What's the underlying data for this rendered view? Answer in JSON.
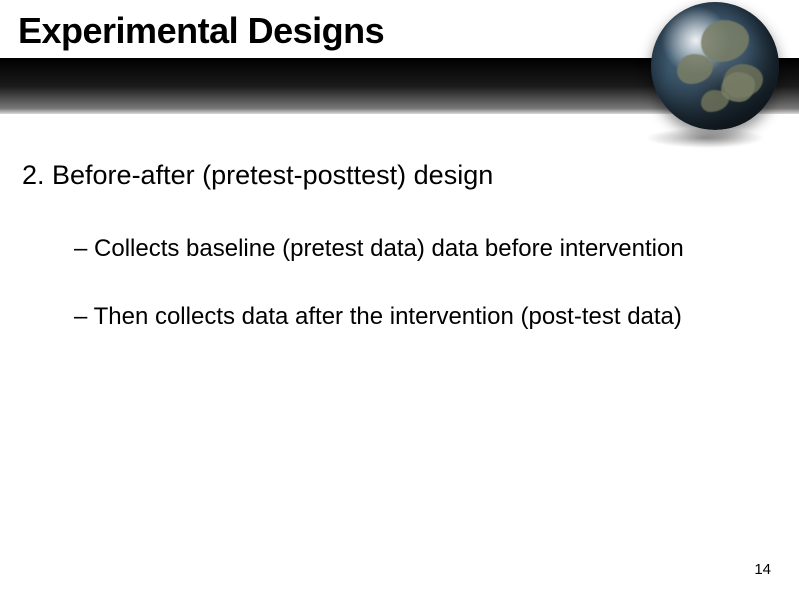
{
  "slide": {
    "title": "Experimental Designs",
    "heading": "2. Before-after (pretest-posttest) design",
    "bullets": [
      "– Collects baseline (pretest data) data before intervention",
      "– Then collects data after the intervention (post-test data)"
    ],
    "page_number": "14"
  },
  "decor": {
    "globe": "earth-globe-icon"
  }
}
